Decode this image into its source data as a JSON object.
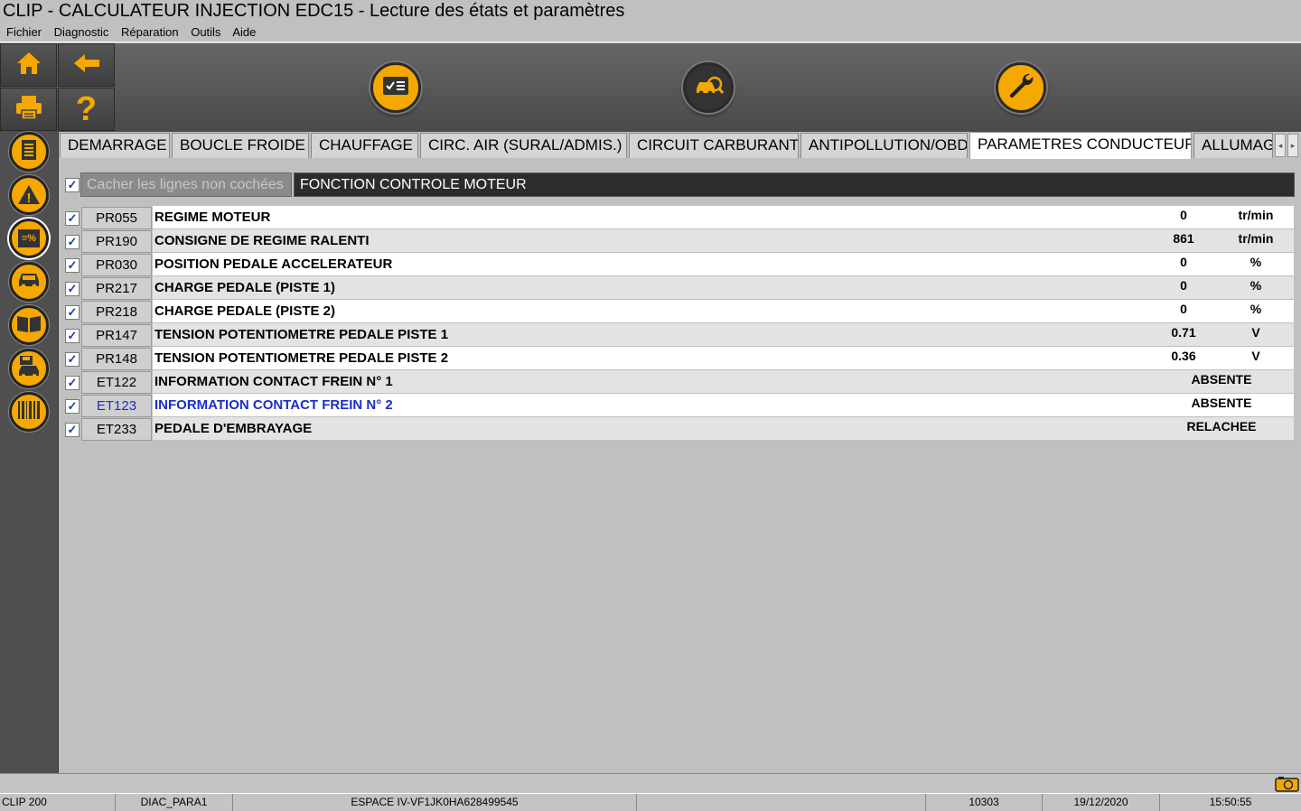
{
  "window": {
    "title": "CLIP - CALCULATEUR INJECTION EDC15 - Lecture des états et paramètres"
  },
  "menu": [
    "Fichier",
    "Diagnostic",
    "Réparation",
    "Outils",
    "Aide"
  ],
  "toolbar": {
    "left_buttons": [
      "home-icon",
      "back-arrow-icon",
      "printer-icon",
      "help-icon"
    ],
    "help_glyph": "?",
    "center_buttons": [
      "checklist-icon",
      "vehicle-scan-icon",
      "wrench-icon"
    ]
  },
  "sidebar": [
    "document-icon",
    "warning-icon",
    "parameters-icon",
    "vehicle-icon",
    "manual-icon",
    "save-vehicle-icon",
    "barcode-icon"
  ],
  "sidebar_glyphs": {
    "warning": "!",
    "parameters": "≡%"
  },
  "tabs": [
    "DEMARRAGE",
    "BOUCLE FROIDE",
    "CHAUFFAGE",
    "CIRC. AIR (SURAL/ADMIS.)",
    "CIRCUIT CARBURANT",
    "ANTIPOLLUTION/OBD",
    "PARAMETRES CONDUCTEUR",
    "ALLUMAGE"
  ],
  "active_tab": "PARAMETRES CONDUCTEUR",
  "tab_arrows": {
    "left": "◂",
    "right": "▸"
  },
  "filter": {
    "checked": "✓",
    "hide_label": "Cacher les lignes non cochées",
    "function_title": "FONCTION CONTROLE MOTEUR"
  },
  "rows": [
    {
      "code": "PR055",
      "label": "REGIME MOTEUR",
      "value": "0",
      "unit": "tr/min"
    },
    {
      "code": "PR190",
      "label": "CONSIGNE DE REGIME RALENTI",
      "value": "861",
      "unit": "tr/min"
    },
    {
      "code": "PR030",
      "label": "POSITION PEDALE ACCELERATEUR",
      "value": "0",
      "unit": "%"
    },
    {
      "code": "PR217",
      "label": "CHARGE PEDALE (PISTE 1)",
      "value": "0",
      "unit": "%"
    },
    {
      "code": "PR218",
      "label": "CHARGE PEDALE (PISTE 2)",
      "value": "0",
      "unit": "%"
    },
    {
      "code": "PR147",
      "label": "TENSION POTENTIOMETRE PEDALE PISTE 1",
      "value": "0.71",
      "unit": "V"
    },
    {
      "code": "PR148",
      "label": "TENSION POTENTIOMETRE PEDALE PISTE 2",
      "value": "0.36",
      "unit": "V"
    },
    {
      "code": "ET122",
      "label": "INFORMATION CONTACT FREIN N° 1",
      "value": "ABSENTE",
      "unit": ""
    },
    {
      "code": "ET123",
      "label": "INFORMATION CONTACT FREIN N° 2",
      "value": "ABSENTE",
      "unit": ""
    },
    {
      "code": "ET233",
      "label": "PEDALE D'EMBRAYAGE",
      "value": "RELACHEE",
      "unit": ""
    }
  ],
  "highlighted_row": "ET123",
  "status": {
    "device": "CLIP 200",
    "session": "DIAC_PARA1",
    "vehicle": "ESPACE IV-VF1JK0HA628499545",
    "blank": "",
    "code": "10303",
    "date": "19/12/2020",
    "time": "15:50:55"
  },
  "colors": {
    "accent": "#f5a800",
    "highlight_text": "#1a2ec8",
    "toolbar": "#555555"
  }
}
